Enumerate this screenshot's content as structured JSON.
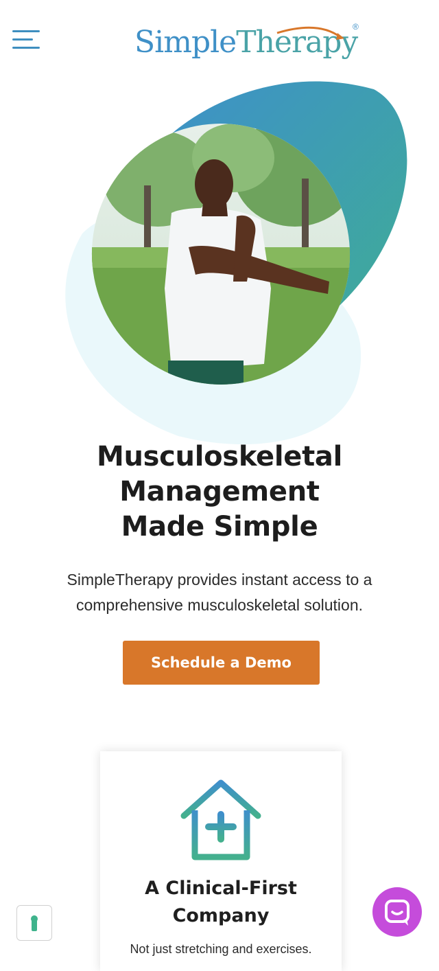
{
  "header": {
    "brand_part1": "Simple",
    "brand_part2": "Therapy",
    "registered_mark": "®",
    "menu_icon": "hamburger-menu-icon"
  },
  "hero": {
    "image_alt": "Man stretching his arm outdoors in a park",
    "headline_lines": [
      "Musculoskeletal",
      "Management",
      "Made Simple"
    ],
    "subtitle": "SimpleTherapy provides instant access to a comprehensive musculoskeletal solution.",
    "cta_label": "Schedule a Demo"
  },
  "feature_card": {
    "icon": "house-plus-icon",
    "title_lines": [
      "A Clinical-First",
      "Company"
    ],
    "description": "Not just stretching and exercises."
  },
  "widgets": {
    "accessibility_icon": "keyhole-icon",
    "chat_icon": "chat-icon"
  },
  "colors": {
    "brand_blue": "#3f90c7",
    "brand_teal": "#4aa3a7",
    "cta_orange": "#d8772a",
    "chat_purple": "#c54cdb",
    "light_blob": "#eaf8fb"
  }
}
